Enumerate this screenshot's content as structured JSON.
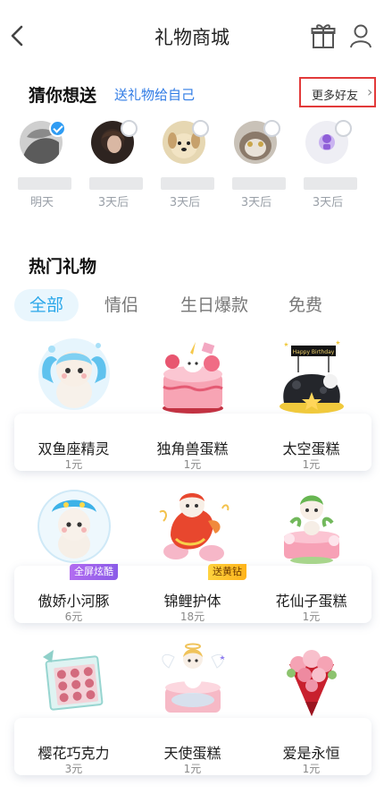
{
  "nav": {
    "title": "礼物商城",
    "back_icon": "chevron-left-icon",
    "gift_icon": "gift-icon",
    "user_icon": "user-icon"
  },
  "guess": {
    "title": "猜你想送",
    "subtitle": "送礼物给自己",
    "more": "更多好友",
    "friends": [
      {
        "when": "明天",
        "selected": true
      },
      {
        "when": "3天后",
        "selected": false
      },
      {
        "when": "3天后",
        "selected": false
      },
      {
        "when": "3天后",
        "selected": false
      },
      {
        "when": "3天后",
        "selected": false
      }
    ]
  },
  "hot": {
    "title": "热门礼物",
    "tabs": [
      "全部",
      "情侣",
      "生日爆款",
      "免费"
    ],
    "active_tab": 0,
    "gifts": [
      {
        "name": "双鱼座精灵",
        "price": "1元"
      },
      {
        "name": "独角兽蛋糕",
        "price": "1元"
      },
      {
        "name": "太空蛋糕",
        "price": "1元"
      },
      {
        "name": "傲娇小河豚",
        "price": "6元",
        "badge": "全屏炫酷"
      },
      {
        "name": "锦鲤护体",
        "price": "18元",
        "badge": "送黄钻"
      },
      {
        "name": "花仙子蛋糕",
        "price": "1元"
      },
      {
        "name": "樱花巧克力",
        "price": "3元"
      },
      {
        "name": "天使蛋糕",
        "price": "1元"
      },
      {
        "name": "爱是永恒",
        "price": "1元"
      }
    ],
    "cake_topper": "Happy Birthday"
  },
  "colors": {
    "accent": "#2aa7e9",
    "link": "#2f7be5",
    "highlight_border": "#e23a3a"
  }
}
